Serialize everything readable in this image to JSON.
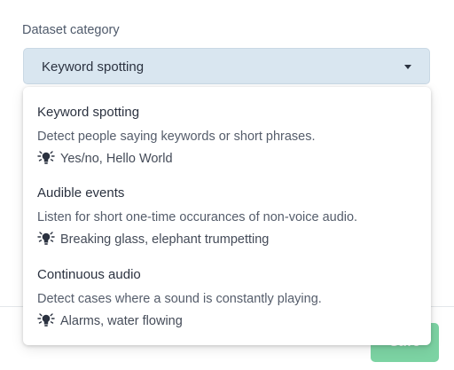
{
  "field": {
    "label": "Dataset category",
    "selected_value": "Keyword spotting"
  },
  "menu": {
    "options": [
      {
        "title": "Keyword spotting",
        "description": "Detect people saying keywords or short phrases.",
        "examples": "Yes/no, Hello World",
        "icon": "lightbulb-icon"
      },
      {
        "title": "Audible events",
        "description": "Listen for short one-time occurances of non-voice audio.",
        "examples": "Breaking glass, elephant trumpetting",
        "icon": "lightbulb-icon"
      },
      {
        "title": "Continuous audio",
        "description": "Detect cases where a sound is constantly playing.",
        "examples": "Alarms, water flowing",
        "icon": "lightbulb-icon"
      }
    ]
  },
  "footer": {
    "save_label": "Save"
  },
  "colors": {
    "select_background": "#d9e6f0",
    "save_button": "#7cd3a3"
  }
}
